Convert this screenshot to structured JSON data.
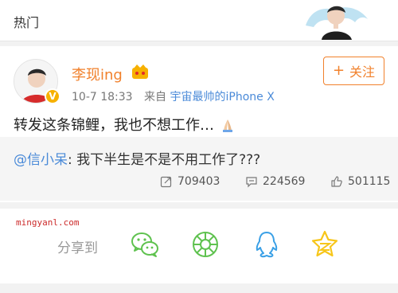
{
  "header": {
    "title": "热门"
  },
  "post": {
    "username": "李现ing",
    "time": "10-7 18:33",
    "source_prefix": "来自",
    "source": "宇宙最帅的iPhone X",
    "follow_label": "关注",
    "follow_plus": "+",
    "text": "转发这条锦鲤，我也不想工作…",
    "vip_badge": "V"
  },
  "quote": {
    "mention": "@信小呆",
    "separator": ": ",
    "text": "我下半生是不是不用工作了???"
  },
  "stats": {
    "reposts": "709403",
    "comments": "224569",
    "likes": "501115"
  },
  "share": {
    "watermark": "mingyanl.com",
    "label": "分享到",
    "targets": [
      "wechat-icon",
      "moments-icon",
      "qq-icon",
      "qzone-icon"
    ]
  },
  "colors": {
    "accent": "#f1812c",
    "link": "#4a8ad8",
    "share_green": "#5fc24f",
    "share_blue": "#3aa0e6",
    "share_yellow": "#f7c61a"
  }
}
